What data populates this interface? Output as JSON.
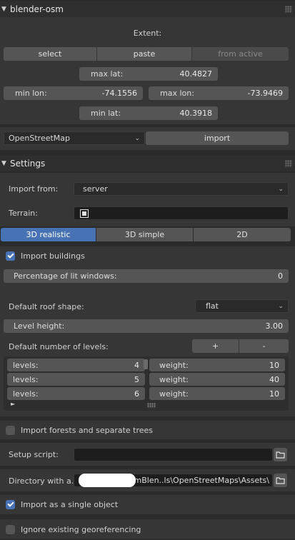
{
  "osm_panel": {
    "title": "blender-osm",
    "extent_label": "Extent:",
    "select_label": "select",
    "paste_label": "paste",
    "from_active_label": "from active",
    "max_lat": {
      "label": "max lat:",
      "value": "40.4827"
    },
    "min_lon": {
      "label": "min lon:",
      "value": "-74.1556"
    },
    "max_lon": {
      "label": "max lon:",
      "value": "-73.9469"
    },
    "min_lat": {
      "label": "min lat:",
      "value": "40.3918"
    },
    "source_selected": "OpenStreetMap",
    "import_label": "import"
  },
  "settings_panel": {
    "title": "Settings",
    "import_from_label": "Import from:",
    "import_from_value": "server",
    "terrain_label": "Terrain:",
    "modes": [
      "3D realistic",
      "3D simple",
      "2D"
    ],
    "active_mode": "3D realistic",
    "import_buildings_label": "Import buildings",
    "import_buildings_checked": true,
    "lit_windows": {
      "label": "Percentage of lit windows:",
      "value": "0"
    },
    "roof_shape_label": "Default roof shape:",
    "roof_shape_value": "flat",
    "level_height": {
      "label": "Level height:",
      "value": "3.00"
    },
    "levels_label": "Default number of levels:",
    "plus_label": "+",
    "minus_label": "-",
    "level_rows": [
      {
        "levels_label": "levels:",
        "levels": "4",
        "weight_label": "weight:",
        "weight": "10"
      },
      {
        "levels_label": "levels:",
        "levels": "5",
        "weight_label": "weight:",
        "weight": "40"
      },
      {
        "levels_label": "levels:",
        "levels": "6",
        "weight_label": "weight:",
        "weight": "10"
      }
    ],
    "import_forests_label": "Import forests and separate trees",
    "import_forests_checked": false,
    "setup_script_label": "Setup script:",
    "setup_script_value": "",
    "directory_label": "Directory with a..",
    "directory_value": "\\FromBlen..ls\\OpenStreetMaps\\Assets\\",
    "single_object_label": "Import as a single object",
    "single_object_checked": true,
    "ignore_geo_label": "Ignore existing georeferencing",
    "ignore_geo_checked": false
  }
}
